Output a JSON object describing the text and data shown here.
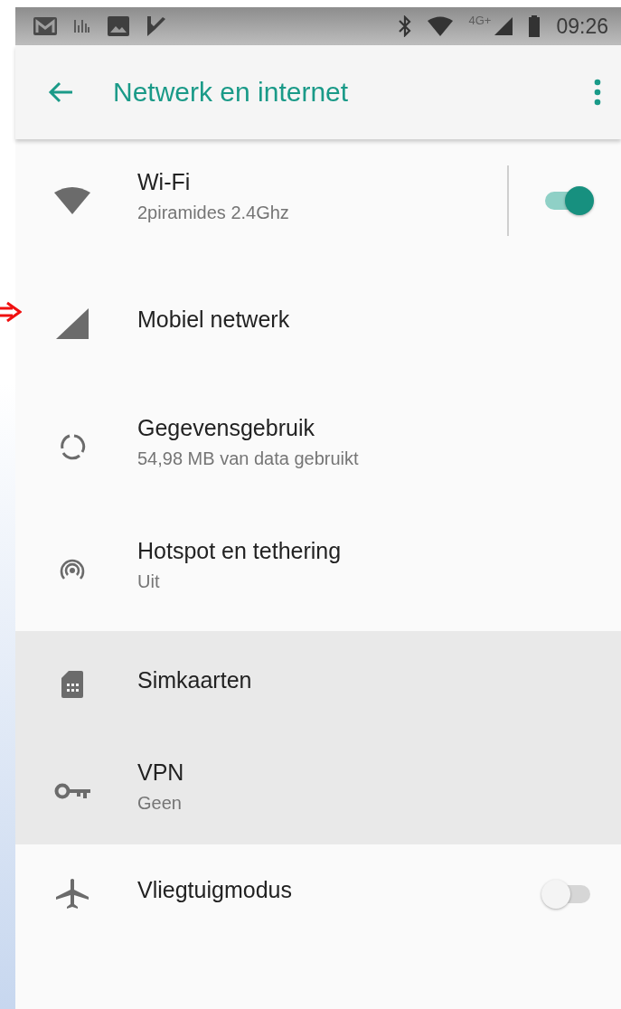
{
  "status_bar": {
    "network_label": "4G+",
    "time": "09:26"
  },
  "app_bar": {
    "title": "Netwerk en internet"
  },
  "items": [
    {
      "title": "Wi-Fi",
      "subtitle": "2piramides 2.4Ghz",
      "highlighted": false,
      "kind": "switch",
      "on": true
    },
    {
      "title": "Mobiel netwerk",
      "highlighted": false,
      "kind": "plain"
    },
    {
      "title": "Gegevensgebruik",
      "subtitle": "54,98 MB van data gebruikt",
      "highlighted": false,
      "kind": "plain"
    },
    {
      "title": "Hotspot en tethering",
      "subtitle": "Uit",
      "highlighted": false,
      "kind": "plain"
    },
    {
      "title": "Simkaarten",
      "highlighted": true,
      "kind": "plain"
    },
    {
      "title": "VPN",
      "subtitle": "Geen",
      "highlighted": true,
      "kind": "plain"
    },
    {
      "title": "Vliegtuigmodus",
      "highlighted": false,
      "kind": "switch",
      "on": false
    }
  ]
}
